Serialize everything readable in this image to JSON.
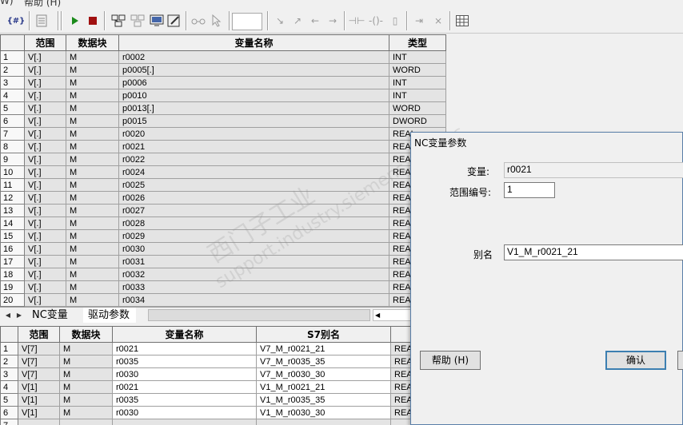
{
  "menubar": {
    "items": [
      "W)",
      "帮助 (H)"
    ]
  },
  "toolbar": {
    "field_value": ""
  },
  "top_table": {
    "headers": [
      "",
      "范围",
      "数据块",
      "变量名称",
      "类型"
    ],
    "rows": [
      [
        "1",
        "V[.]",
        "M",
        "r0002",
        "INT"
      ],
      [
        "2",
        "V[.]",
        "M",
        "p0005[.]",
        "WORD"
      ],
      [
        "3",
        "V[.]",
        "M",
        "p0006",
        "INT"
      ],
      [
        "4",
        "V[.]",
        "M",
        "p0010",
        "INT"
      ],
      [
        "5",
        "V[.]",
        "M",
        "p0013[.]",
        "WORD"
      ],
      [
        "6",
        "V[.]",
        "M",
        "p0015",
        "DWORD"
      ],
      [
        "7",
        "V[.]",
        "M",
        "r0020",
        "REAL"
      ],
      [
        "8",
        "V[.]",
        "M",
        "r0021",
        "REAL"
      ],
      [
        "9",
        "V[.]",
        "M",
        "r0022",
        "REAL"
      ],
      [
        "10",
        "V[.]",
        "M",
        "r0024",
        "REAL"
      ],
      [
        "11",
        "V[.]",
        "M",
        "r0025",
        "REAL"
      ],
      [
        "12",
        "V[.]",
        "M",
        "r0026",
        "REAL"
      ],
      [
        "13",
        "V[.]",
        "M",
        "r0027",
        "REAL"
      ],
      [
        "14",
        "V[.]",
        "M",
        "r0028",
        "REAL"
      ],
      [
        "15",
        "V[.]",
        "M",
        "r0029",
        "REAL"
      ],
      [
        "16",
        "V[.]",
        "M",
        "r0030",
        "REAL"
      ],
      [
        "17",
        "V[.]",
        "M",
        "r0031",
        "REAL"
      ],
      [
        "18",
        "V[.]",
        "M",
        "r0032",
        "REAL"
      ],
      [
        "19",
        "V[.]",
        "M",
        "r0033",
        "REAL"
      ],
      [
        "20",
        "V[.]",
        "M",
        "r0034",
        "REAL"
      ]
    ]
  },
  "tabs": {
    "items": [
      "NC变量",
      "驱动参数"
    ],
    "active_index": 1
  },
  "bottom_table": {
    "headers": [
      "",
      "范围",
      "数据块",
      "变量名称",
      "S7别名",
      "类"
    ],
    "rows": [
      [
        "1",
        "V[7]",
        "M",
        "r0021",
        "V7_M_r0021_21",
        "REAL"
      ],
      [
        "2",
        "V[7]",
        "M",
        "r0035",
        "V7_M_r0035_35",
        "REAL"
      ],
      [
        "3",
        "V[7]",
        "M",
        "r0030",
        "V7_M_r0030_30",
        "REAL"
      ],
      [
        "4",
        "V[1]",
        "M",
        "r0021",
        "V1_M_r0021_21",
        "REAL"
      ],
      [
        "5",
        "V[1]",
        "M",
        "r0035",
        "V1_M_r0035_35",
        "REAL"
      ],
      [
        "6",
        "V[1]",
        "M",
        "r0030",
        "V1_M_r0030_30",
        "REAL"
      ],
      [
        "7",
        "",
        "",
        "",
        "",
        ""
      ]
    ]
  },
  "dialog": {
    "title": "NC变量参数",
    "variable_label": "变量:",
    "variable_value": "r0021",
    "range_label": "范围编号:",
    "range_value": "1",
    "alias_label": "别名",
    "alias_value": "V1_M_r0021_21",
    "help_button": "帮助 (H)",
    "ok_button": "确认"
  },
  "watermark": {
    "line1": "西门子工业",
    "line2": "support.industry.siemens.com/cs"
  },
  "colors": {
    "dialog_border": "#5a7fa8",
    "default_button_border": "#3c7fb1",
    "play_icon": "#1a8a1a",
    "stop_icon": "#a01010"
  }
}
